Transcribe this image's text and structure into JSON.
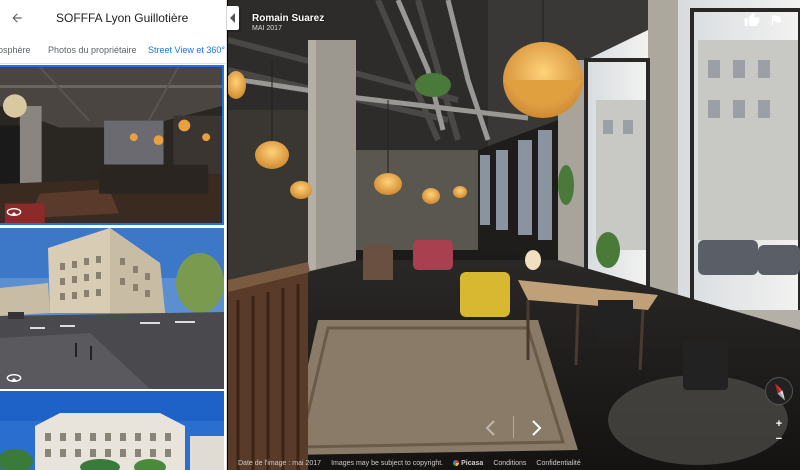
{
  "place": {
    "title": "SOFFFA Lyon Guillotière"
  },
  "tabs": [
    {
      "label": "osphère"
    },
    {
      "label": "Photos du propriétaire"
    },
    {
      "label": "Street View et 360°"
    }
  ],
  "viewer": {
    "contributor_name": "Romain Suarez",
    "contributor_date": "MAI 2017",
    "zoom_in": "+",
    "zoom_out": "−"
  },
  "footer": {
    "image_date": "Date de l'image : mai 2017",
    "copyright": "Images may be subject to copyright.",
    "logo_text": "Picasa",
    "conditions": "Conditions",
    "privacy": "Confidentialité"
  },
  "icons": {
    "back": "arrow-left-icon",
    "collapse": "chevron-left-icon",
    "thumb_up": "thumb-up-icon",
    "flag": "flag-icon",
    "panorama": "panorama-icon",
    "compass": "compass-icon",
    "prev": "chevron-left-icon",
    "next": "chevron-right-icon"
  },
  "colors": {
    "accent": "#1a73e8",
    "panel_bg": "#ffffff",
    "compass_red": "#e53935"
  }
}
